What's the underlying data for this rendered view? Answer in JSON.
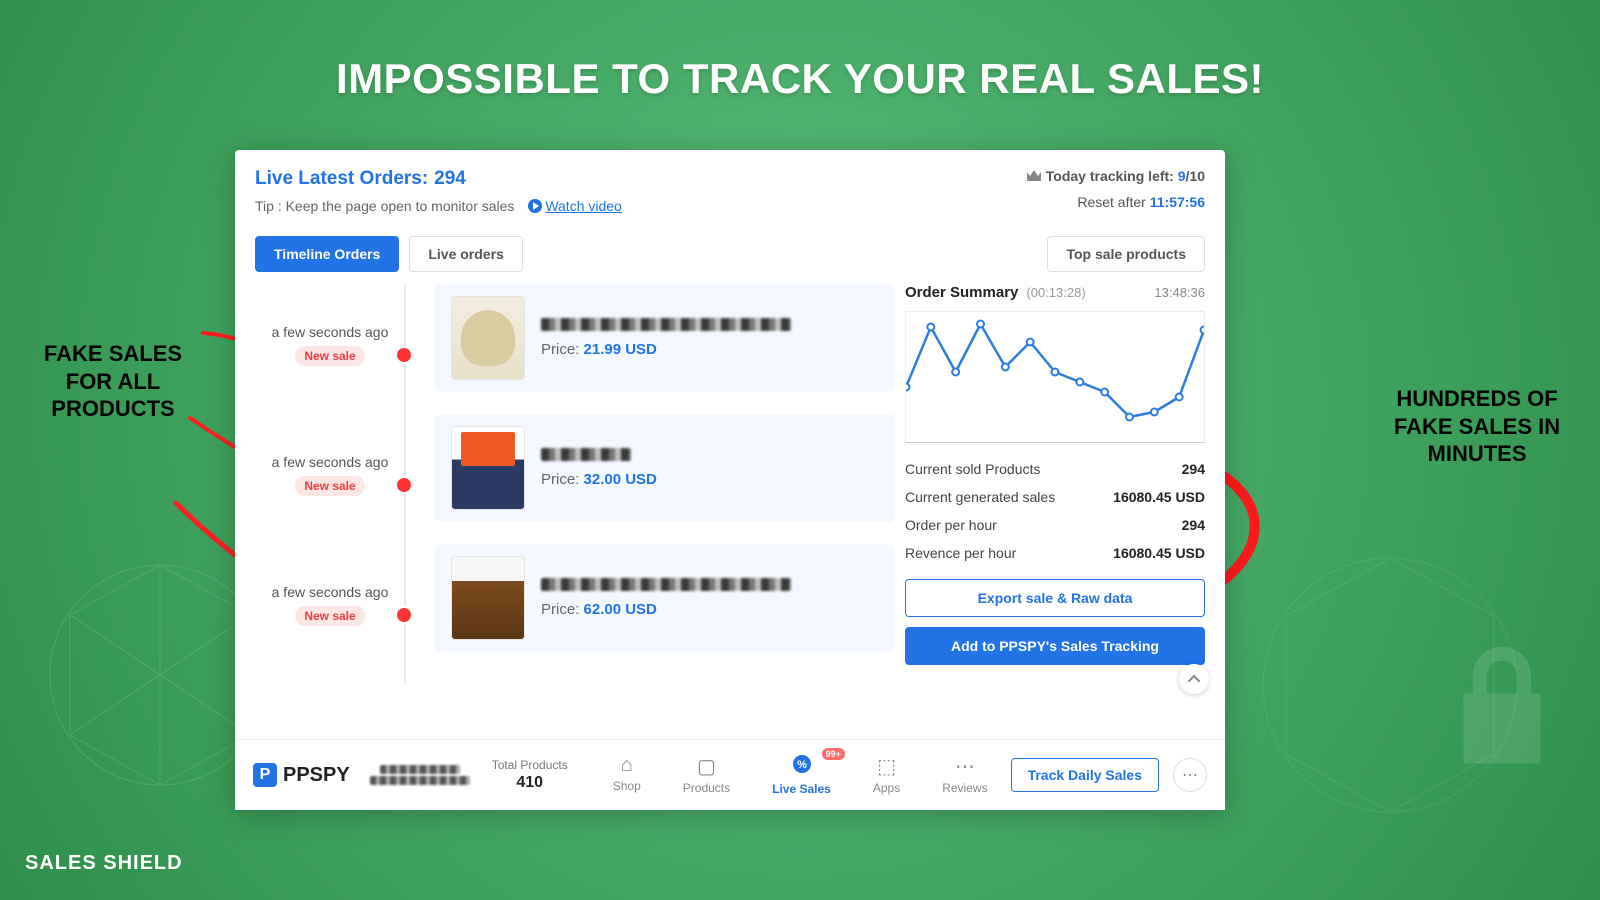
{
  "headline": "IMPOSSIBLE TO TRACK YOUR REAL SALES!",
  "annot_left": "FAKE SALES FOR ALL PRODUCTS",
  "annot_right": "HUNDREDS OF FAKE SALES IN MINUTES",
  "brand": "SALES SHIELD",
  "header": {
    "title_label": "Live Latest Orders:",
    "title_count": "294",
    "tip": "Tip : Keep the page open to monitor sales",
    "watch_video": "Watch video",
    "tracking_label": "Today tracking left:",
    "tracking_used": "9",
    "tracking_of": "/10",
    "reset_label": "Reset after",
    "reset_value": "11:57:56"
  },
  "tabs": {
    "timeline": "Timeline Orders",
    "live": "Live orders",
    "top": "Top sale products"
  },
  "events": [
    {
      "ago": "a few seconds ago",
      "badge": "New sale",
      "price": "21.99 USD"
    },
    {
      "ago": "a few seconds ago",
      "badge": "New sale",
      "price": "32.00 USD"
    },
    {
      "ago": "a few seconds ago",
      "badge": "New sale",
      "price": "62.00 USD"
    }
  ],
  "price_prefix": "Price:",
  "summary": {
    "title": "Order Summary",
    "parens": "(00:13:28)",
    "time": "13:48:36",
    "rows": [
      {
        "label": "Current sold Products",
        "value": "294"
      },
      {
        "label": "Current generated sales",
        "value": "16080.45 USD"
      },
      {
        "label": "Order per hour",
        "value": "294"
      },
      {
        "label": "Revence per hour",
        "value": "16080.45 USD"
      }
    ],
    "export_btn": "Export sale & Raw data",
    "add_btn": "Add to PPSPY's Sales Tracking"
  },
  "bottombar": {
    "logo": "PPSPY",
    "total_products_label": "Total Products",
    "total_products_value": "410",
    "nav": {
      "shop": "Shop",
      "products": "Products",
      "live": "Live Sales",
      "apps": "Apps",
      "reviews": "Reviews"
    },
    "badge99": "99+",
    "track_btn": "Track Daily Sales"
  },
  "chart_data": {
    "type": "line",
    "x": [
      0,
      1,
      2,
      3,
      4,
      5,
      6,
      7,
      8,
      9,
      10,
      11,
      12
    ],
    "values": [
      55,
      115,
      70,
      118,
      75,
      100,
      70,
      60,
      50,
      25,
      30,
      45,
      112
    ],
    "ylim": [
      0,
      130
    ]
  }
}
